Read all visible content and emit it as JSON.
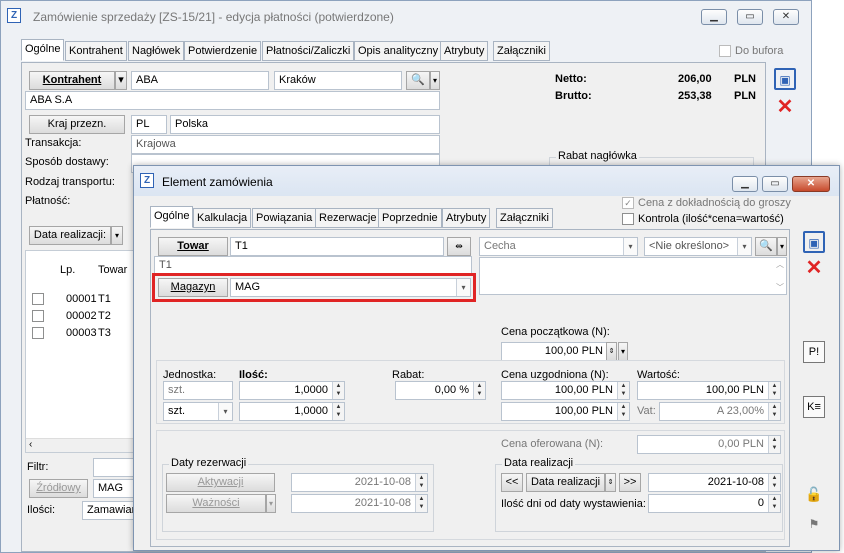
{
  "back": {
    "title": "Zamówienie sprzedaży [ZS-15/21] - edycja płatności  (potwierdzone)",
    "tabs": [
      "Ogólne",
      "Kontrahent",
      "Nagłówek",
      "Potwierdzenie",
      "Płatności/Zaliczki",
      "Opis analityczny",
      "Atrybuty",
      "Załączniki"
    ],
    "do_bufora": "Do bufora",
    "kontrahent_btn": "Kontrahent",
    "kontrahent_code": "ABA",
    "kontrahent_city": "Kraków",
    "kontrahent_name": "ABA S.A",
    "kraj_btn": "Kraj przezn.",
    "kraj_code": "PL",
    "kraj_name": "Polska",
    "transakcja_lbl": "Transakcja:",
    "transakcja_val": "Krajowa",
    "sposob_lbl": "Sposób dostawy:",
    "rodzaj_lbl": "Rodzaj transportu:",
    "platnosc_lbl": "Płatność:",
    "netto_lbl": "Netto:",
    "netto_val": "206,00",
    "netto_cur": "PLN",
    "brutto_lbl": "Brutto:",
    "brutto_val": "253,38",
    "brutto_cur": "PLN",
    "rabat_lbl": "Rabat nagłówka",
    "data_real_btn": "Data realizacji:",
    "col_lp": "Lp.",
    "col_towar": "Towar",
    "rows": [
      {
        "lp": "00001",
        "towar": "T1"
      },
      {
        "lp": "00002",
        "towar": "T2"
      },
      {
        "lp": "00003",
        "towar": "T3"
      }
    ],
    "filtr_lbl": "Filtr:",
    "zrodlowy_btn": "Źródłowy",
    "zrodlowy_val": "MAG",
    "ilosci_lbl": "Ilości:",
    "ilosci_val": "Zamawiane"
  },
  "front": {
    "title": "Element zamówienia",
    "tabs": [
      "Ogólne",
      "Kalkulacja",
      "Powiązania",
      "Rezerwacje",
      "Poprzednie",
      "Atrybuty",
      "Załączniki"
    ],
    "cena_dokl": "Cena z dokładnością do groszy",
    "kontrola": "Kontrola (ilość*cena=wartość)",
    "towar_btn": "Towar",
    "towar_code": "T1",
    "towar_name": "T1",
    "cecha_ph": "Cecha",
    "nie_okreslono": "<Nie określono>",
    "magazyn_btn": "Magazyn",
    "magazyn_val": "MAG",
    "cena_pocz_lbl": "Cena początkowa (N):",
    "cena_pocz_val": "100,00 PLN",
    "jednostka_lbl": "Jednostka:",
    "ilosc_lbl": "Ilość:",
    "rabat_lbl": "Rabat:",
    "cena_uzg_lbl": "Cena uzgodniona (N):",
    "wartosc_lbl": "Wartość:",
    "jednostka_val": "szt.",
    "jednostka_sel": "szt.",
    "ilosc1": "1,0000",
    "ilosc2": "1,0000",
    "rabat_val": "0,00 %",
    "cena_uzg1": "100,00 PLN",
    "cena_uzg2": "100,00 PLN",
    "wartosc1": "100,00 PLN",
    "vat_lbl": "Vat:",
    "vat_val": "A 23,00%",
    "cena_ofer_lbl": "Cena oferowana (N):",
    "cena_ofer_val": "0,00 PLN",
    "daty_rez_lbl": "Daty rezerwacji",
    "aktywacji_btn": "Aktywacji",
    "aktywacji_val": "2021-10-08",
    "waznosci_btn": "Ważności",
    "waznosci_val": "2021-10-08",
    "data_real_grp": "Data realizacji",
    "prev_btn": "<<",
    "data_real_btn": "Data realizacji",
    "next_btn": ">>",
    "data_real_val": "2021-10-08",
    "ilosc_dni_lbl": "Ilość dni od daty wystawienia:",
    "ilosc_dni_val": "0"
  },
  "colors": {
    "highlight": "#e02424",
    "accent": "#2f63b5"
  }
}
